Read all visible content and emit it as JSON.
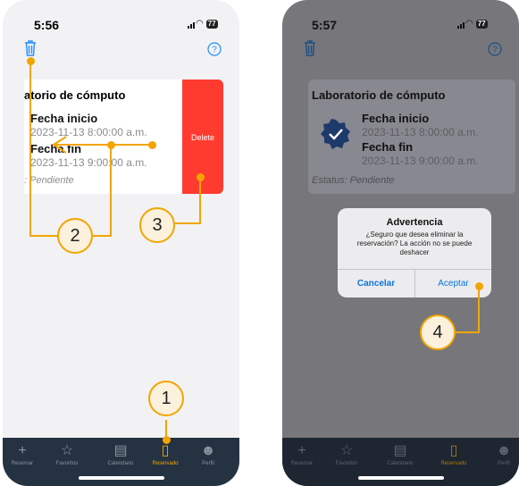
{
  "left": {
    "time": "5:56",
    "battery": "77",
    "card": {
      "title": "atorio de cómputo",
      "start_label": "Fecha inicio",
      "start_value": "2023-11-13 8:00:00 a.m.",
      "end_label": "Fecha fin",
      "end_value": "2023-11-13 9:00:00 a.m.",
      "status": ": Pendiente"
    },
    "delete_label": "Delete"
  },
  "right": {
    "time": "5:57",
    "battery": "77",
    "card": {
      "title": "Laboratorio de cómputo",
      "start_label": "Fecha inicio",
      "start_value": "2023-11-13 8:00:00 a.m.",
      "end_label": "Fecha fin",
      "end_value": "2023-11-13 9:00:00 a.m.",
      "status": "Estatus: Pendiente"
    },
    "alert": {
      "title": "Advertencia",
      "message": "¿Seguro que desea eliminar la reservación? La acción no se puede deshacer",
      "cancel": "Cancelar",
      "accept": "Aceptar"
    }
  },
  "tabs": [
    "Reservar",
    "Favoritos",
    "Calendario",
    "Reservado",
    "Perfil"
  ],
  "tab_icons": [
    "plus-icon",
    "star-icon",
    "calendar-icon",
    "bookmark-icon",
    "person-icon"
  ],
  "active_tab": "Reservado",
  "callouts": [
    "1",
    "2",
    "3",
    "4"
  ],
  "colors": {
    "accent": "#f2a500",
    "delete": "#ff3b30",
    "tabbar": "#253241",
    "link": "#007aff",
    "badge": "#1d3a6b"
  }
}
